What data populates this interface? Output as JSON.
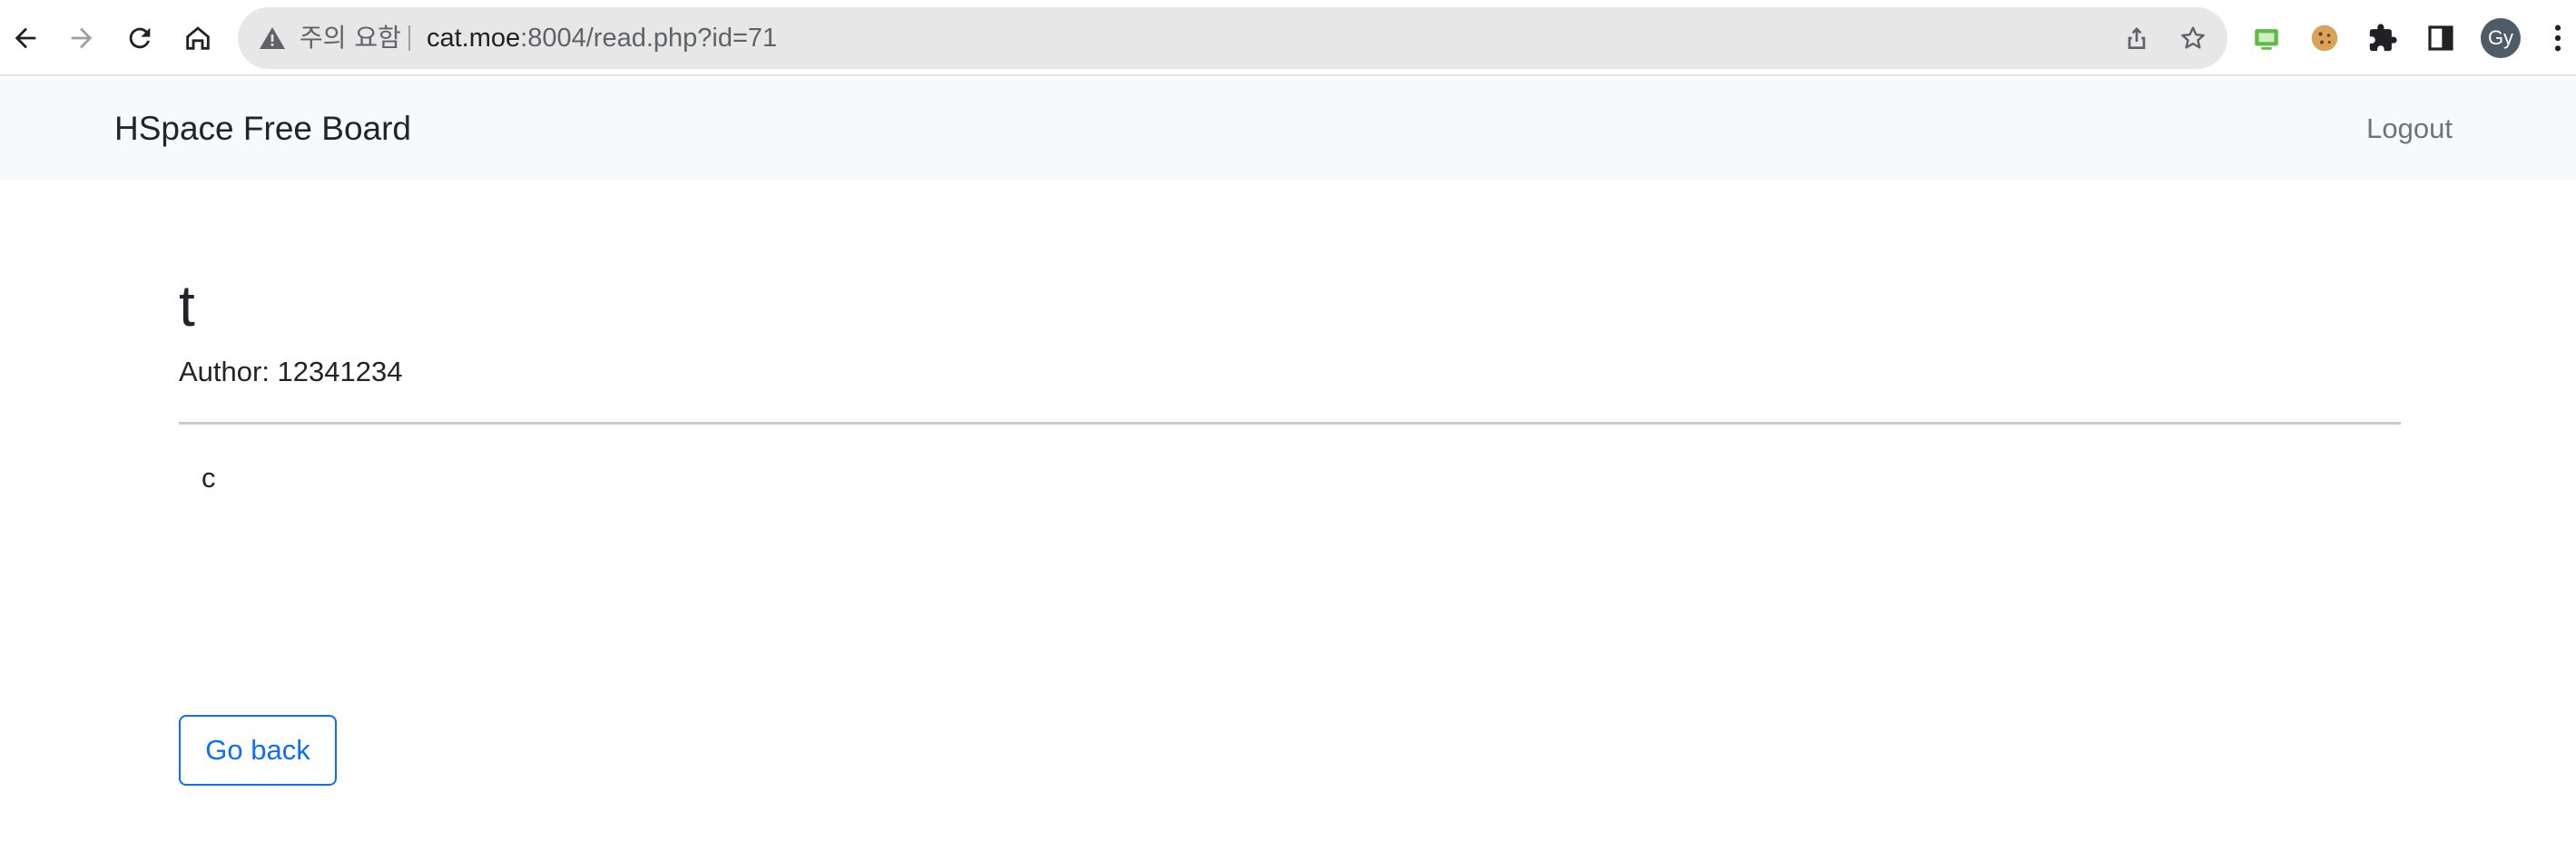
{
  "browser": {
    "security_label": "주의 요함",
    "url_host": "cat.moe",
    "url_rest": ":8004/read.php?id=71",
    "profile_initials": "Gy"
  },
  "navbar": {
    "brand": "HSpace Free Board",
    "logout_label": "Logout"
  },
  "post": {
    "title": "t",
    "author": "Author: 12341234",
    "body": "c"
  },
  "actions": {
    "back_label": "Go back"
  },
  "colors": {
    "primary": "#0d6efd",
    "navbar_bg": "#f8f9fa",
    "muted_text": "#6c757d"
  },
  "icons": [
    "back-arrow-icon",
    "forward-arrow-icon",
    "reload-icon",
    "home-icon",
    "warning-icon",
    "share-icon",
    "star-icon",
    "extension-green-icon",
    "cookie-icon",
    "puzzle-icon",
    "side-panel-icon",
    "kebab-menu-icon"
  ]
}
